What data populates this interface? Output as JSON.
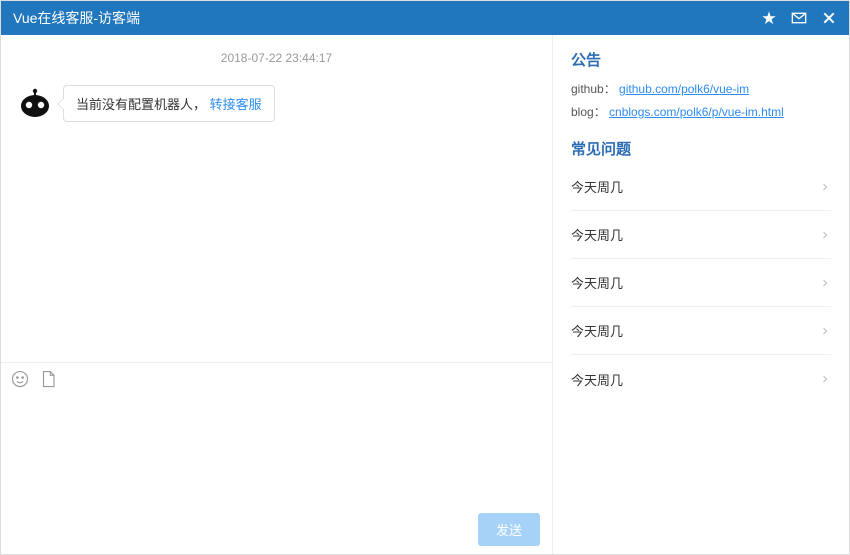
{
  "header": {
    "title": "Vue在线客服-访客端"
  },
  "chat": {
    "timestamp": "2018-07-22 23:44:17",
    "message_text": "当前没有配置机器人，",
    "message_action": "转接客服"
  },
  "input": {
    "send_label": "发送"
  },
  "sidebar": {
    "announcement_title": "公告",
    "github_label": "github：",
    "github_link": "github.com/polk6/vue-im",
    "blog_label": "blog：",
    "blog_link": "cnblogs.com/polk6/p/vue-im.html",
    "faq_title": "常见问题",
    "faq_items": [
      {
        "label": "今天周几"
      },
      {
        "label": "今天周几"
      },
      {
        "label": "今天周几"
      },
      {
        "label": "今天周几"
      },
      {
        "label": "今天周几"
      }
    ]
  }
}
